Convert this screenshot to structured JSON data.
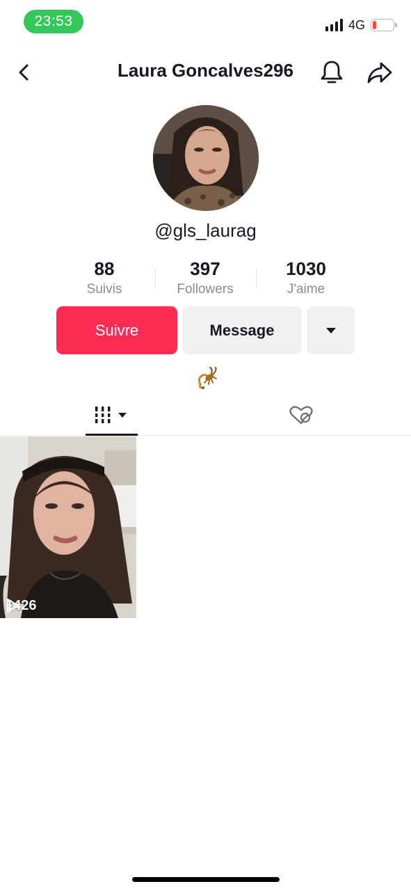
{
  "status_bar": {
    "time": "23:53",
    "network": "4G",
    "battery": "17",
    "battery_level": 0.17,
    "time_pill_color": "#34c759",
    "battery_color": "#ff453a"
  },
  "header": {
    "title": "Laura Goncalves296",
    "back_icon": "chevron-left-icon",
    "bell_icon": "bell-icon",
    "share_icon": "share-arrow-icon"
  },
  "profile": {
    "username": "@gls_laurag",
    "stats": [
      {
        "value": "88",
        "label": "Suivis"
      },
      {
        "value": "397",
        "label": "Followers"
      },
      {
        "value": "1030",
        "label": "J'aime"
      }
    ],
    "bio_emoji_icon": "scorpion-icon"
  },
  "actions": {
    "follow_label": "Suivre",
    "message_label": "Message",
    "more_icon": "caret-down-icon",
    "follow_color": "#fe2c55"
  },
  "tabs": [
    {
      "icon": "videos-grid-icon",
      "selected": true
    },
    {
      "icon": "liked-hidden-icon",
      "selected": false
    }
  ],
  "videos": [
    {
      "views": "1426",
      "play_icon": "play-outline-icon"
    }
  ]
}
